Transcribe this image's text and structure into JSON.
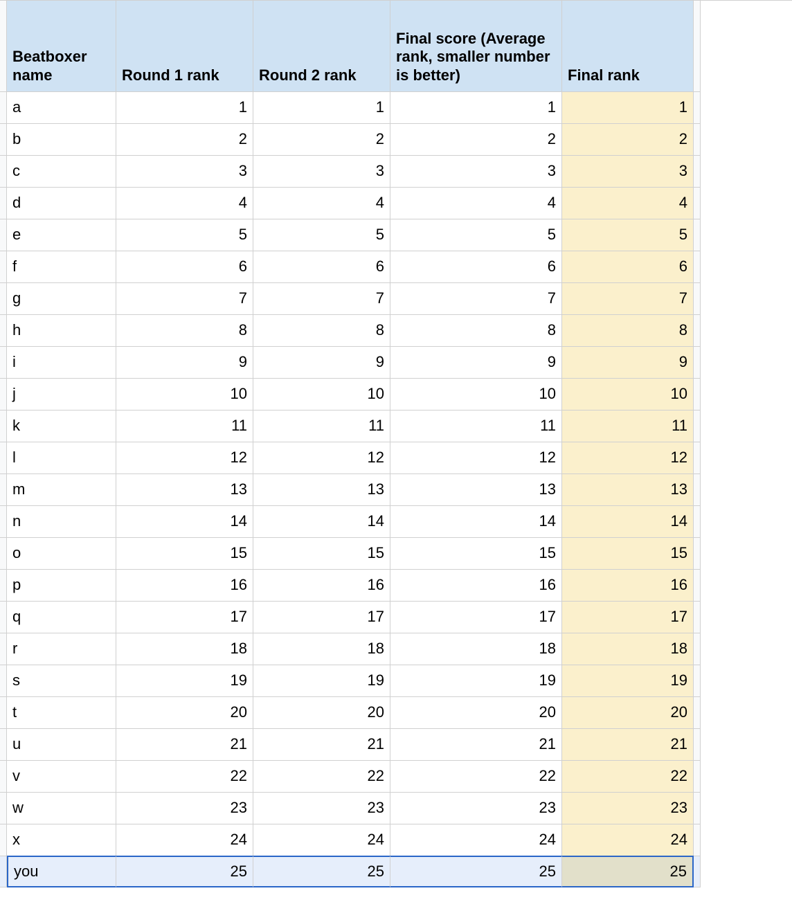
{
  "headers": {
    "c0": "Beatboxer name",
    "c1": "Round 1 rank",
    "c2": "Round 2 rank",
    "c3": "Final score (Average rank, smaller number is better)",
    "c4": "Final rank"
  },
  "rows": [
    {
      "name": "a",
      "r1": 1,
      "r2": 1,
      "score": 1,
      "final": 1,
      "selected": false
    },
    {
      "name": "b",
      "r1": 2,
      "r2": 2,
      "score": 2,
      "final": 2,
      "selected": false
    },
    {
      "name": "c",
      "r1": 3,
      "r2": 3,
      "score": 3,
      "final": 3,
      "selected": false
    },
    {
      "name": "d",
      "r1": 4,
      "r2": 4,
      "score": 4,
      "final": 4,
      "selected": false
    },
    {
      "name": "e",
      "r1": 5,
      "r2": 5,
      "score": 5,
      "final": 5,
      "selected": false
    },
    {
      "name": "f",
      "r1": 6,
      "r2": 6,
      "score": 6,
      "final": 6,
      "selected": false
    },
    {
      "name": "g",
      "r1": 7,
      "r2": 7,
      "score": 7,
      "final": 7,
      "selected": false
    },
    {
      "name": "h",
      "r1": 8,
      "r2": 8,
      "score": 8,
      "final": 8,
      "selected": false
    },
    {
      "name": "i",
      "r1": 9,
      "r2": 9,
      "score": 9,
      "final": 9,
      "selected": false
    },
    {
      "name": "j",
      "r1": 10,
      "r2": 10,
      "score": 10,
      "final": 10,
      "selected": false
    },
    {
      "name": "k",
      "r1": 11,
      "r2": 11,
      "score": 11,
      "final": 11,
      "selected": false
    },
    {
      "name": "l",
      "r1": 12,
      "r2": 12,
      "score": 12,
      "final": 12,
      "selected": false
    },
    {
      "name": "m",
      "r1": 13,
      "r2": 13,
      "score": 13,
      "final": 13,
      "selected": false
    },
    {
      "name": "n",
      "r1": 14,
      "r2": 14,
      "score": 14,
      "final": 14,
      "selected": false
    },
    {
      "name": "o",
      "r1": 15,
      "r2": 15,
      "score": 15,
      "final": 15,
      "selected": false
    },
    {
      "name": "p",
      "r1": 16,
      "r2": 16,
      "score": 16,
      "final": 16,
      "selected": false
    },
    {
      "name": "q",
      "r1": 17,
      "r2": 17,
      "score": 17,
      "final": 17,
      "selected": false
    },
    {
      "name": "r",
      "r1": 18,
      "r2": 18,
      "score": 18,
      "final": 18,
      "selected": false
    },
    {
      "name": "s",
      "r1": 19,
      "r2": 19,
      "score": 19,
      "final": 19,
      "selected": false
    },
    {
      "name": "t",
      "r1": 20,
      "r2": 20,
      "score": 20,
      "final": 20,
      "selected": false
    },
    {
      "name": "u",
      "r1": 21,
      "r2": 21,
      "score": 21,
      "final": 21,
      "selected": false
    },
    {
      "name": "v",
      "r1": 22,
      "r2": 22,
      "score": 22,
      "final": 22,
      "selected": false
    },
    {
      "name": "w",
      "r1": 23,
      "r2": 23,
      "score": 23,
      "final": 23,
      "selected": false
    },
    {
      "name": "x",
      "r1": 24,
      "r2": 24,
      "score": 24,
      "final": 24,
      "selected": false
    },
    {
      "name": "you",
      "r1": 25,
      "r2": 25,
      "score": 25,
      "final": 25,
      "selected": true
    }
  ],
  "chart_data": {
    "type": "table",
    "columns": [
      "Beatboxer name",
      "Round 1 rank",
      "Round 2 rank",
      "Final score (Average rank, smaller number is better)",
      "Final rank"
    ],
    "rows": [
      [
        "a",
        1,
        1,
        1,
        1
      ],
      [
        "b",
        2,
        2,
        2,
        2
      ],
      [
        "c",
        3,
        3,
        3,
        3
      ],
      [
        "d",
        4,
        4,
        4,
        4
      ],
      [
        "e",
        5,
        5,
        5,
        5
      ],
      [
        "f",
        6,
        6,
        6,
        6
      ],
      [
        "g",
        7,
        7,
        7,
        7
      ],
      [
        "h",
        8,
        8,
        8,
        8
      ],
      [
        "i",
        9,
        9,
        9,
        9
      ],
      [
        "j",
        10,
        10,
        10,
        10
      ],
      [
        "k",
        11,
        11,
        11,
        11
      ],
      [
        "l",
        12,
        12,
        12,
        12
      ],
      [
        "m",
        13,
        13,
        13,
        13
      ],
      [
        "n",
        14,
        14,
        14,
        14
      ],
      [
        "o",
        15,
        15,
        15,
        15
      ],
      [
        "p",
        16,
        16,
        16,
        16
      ],
      [
        "q",
        17,
        17,
        17,
        17
      ],
      [
        "r",
        18,
        18,
        18,
        18
      ],
      [
        "s",
        19,
        19,
        19,
        19
      ],
      [
        "t",
        20,
        20,
        20,
        20
      ],
      [
        "u",
        21,
        21,
        21,
        21
      ],
      [
        "v",
        22,
        22,
        22,
        22
      ],
      [
        "w",
        23,
        23,
        23,
        23
      ],
      [
        "x",
        24,
        24,
        24,
        24
      ],
      [
        "you",
        25,
        25,
        25,
        25
      ]
    ]
  }
}
